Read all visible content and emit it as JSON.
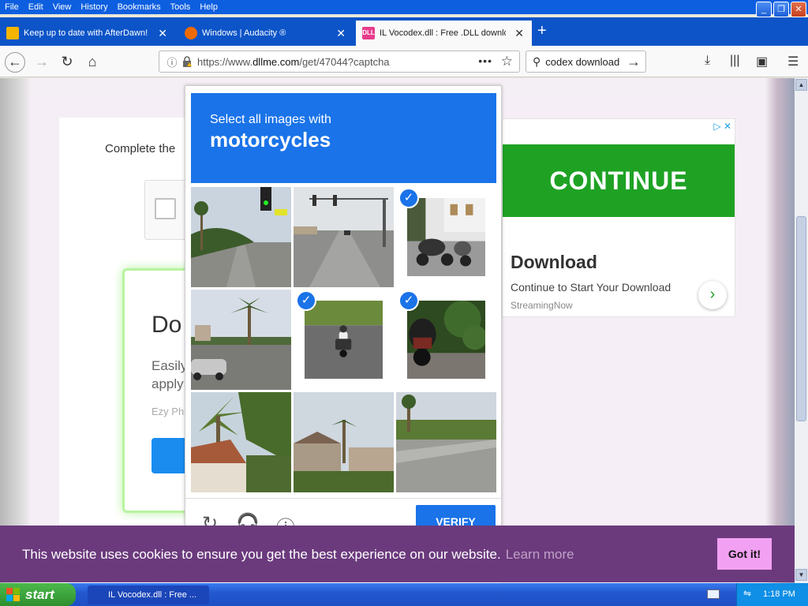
{
  "menubar": {
    "items": [
      "File",
      "Edit",
      "View",
      "History",
      "Bookmarks",
      "Tools",
      "Help"
    ]
  },
  "tabs": [
    {
      "title": "Keep up to date with AfterDawn!",
      "favicon": "afterdawn-icon"
    },
    {
      "title": "Windows | Audacity ®",
      "favicon": "audacity-icon"
    },
    {
      "title": "IL Vocodex.dll : Free .DLL download",
      "favicon": "dll-icon",
      "active": true
    }
  ],
  "nav": {
    "url_prefix": "https://www.",
    "url_domain": "dllme.com",
    "url_path": "/get/47044?captcha",
    "search_text": "codex download"
  },
  "page": {
    "complete_text": "Complete the",
    "heading": "Do",
    "body_l1": "Easily",
    "body_l2": "apply",
    "ezy": "Ezy Ph"
  },
  "ad": {
    "cta": "CONTINUE",
    "heading": "Download",
    "subtitle": "Continue to Start Your Download",
    "source": "StreamingNow"
  },
  "captcha": {
    "instruction": "Select all images with",
    "target": "motorcycles",
    "verify_label": "VERIFY",
    "tiles": [
      {
        "scene": "street-palms-traffic-light",
        "selected": false
      },
      {
        "scene": "road-traffic-light",
        "selected": false
      },
      {
        "scene": "parked-motorcycle",
        "selected": true
      },
      {
        "scene": "palm-tree-road",
        "selected": false
      },
      {
        "scene": "motorcycle-on-road",
        "selected": true
      },
      {
        "scene": "motorcycle-hedge",
        "selected": true
      },
      {
        "scene": "palm-house",
        "selected": false
      },
      {
        "scene": "houses-palm",
        "selected": false
      },
      {
        "scene": "empty-road",
        "selected": false
      }
    ]
  },
  "cookie": {
    "message": "This website uses cookies to ensure you get the best experience on our website.",
    "learn_more": "Learn more",
    "got_it": "Got it!"
  },
  "taskbar": {
    "start": "start",
    "task": "IL Vocodex.dll : Free ...",
    "clock": "1:18 PM"
  },
  "colors": {
    "accent": "#1a73e8",
    "cookie_bg": "#6b3a7d",
    "ad_green": "#1fa224"
  }
}
